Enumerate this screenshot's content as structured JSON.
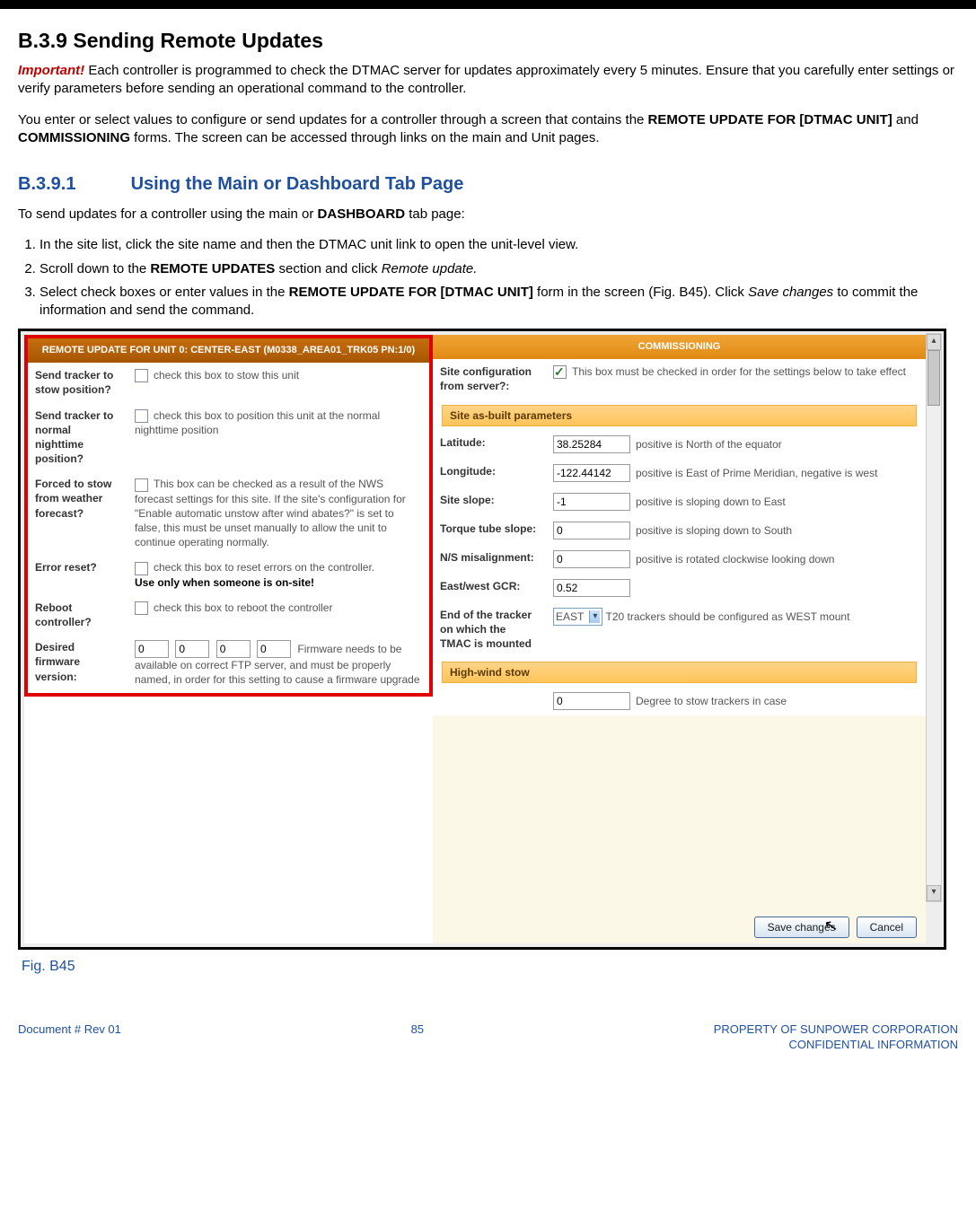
{
  "heading": "B.3.9 Sending Remote Updates",
  "important_label": "Important!",
  "paragraph1": " Each controller is programmed to check the DTMAC server for updates approximately every 5 minutes. Ensure that you carefully enter settings or verify parameters before sending an operational command to the controller.",
  "paragraph2_a": "You enter or select values to configure or send updates for a controller through a screen that contains the ",
  "paragraph2_b": "REMOTE UPDATE FOR [DTMAC UNIT]",
  "paragraph2_c": " and ",
  "paragraph2_d": "COMMISSIONING",
  "paragraph2_e": " forms. The screen can be accessed through links on the main and Unit pages.",
  "subsection_num": "B.3.9.1",
  "subsection_title": "Using the Main or Dashboard Tab Page",
  "intro_a": "To send updates for a controller using the main or ",
  "intro_b": "DASHBOARD",
  "intro_c": " tab page:",
  "steps": {
    "s1": "In the site list, click the site name and then the DTMAC unit link to open the unit-level view.",
    "s2a": "Scroll down to the ",
    "s2b": "REMOTE UPDATES",
    "s2c": " section and click ",
    "s2d": "Remote update.",
    "s3a": "Select check boxes or enter values in the ",
    "s3b": "REMOTE UPDATE FOR [DTMAC UNIT]",
    "s3c": " form in the screen (Fig. B45). Click ",
    "s3d": "Save changes",
    "s3e": " to commit the information and send the command."
  },
  "fig_caption": "Fig. B45",
  "left": {
    "header": "REMOTE UPDATE FOR UNIT 0: CENTER-EAST (M0338_AREA01_TRK05 PN:1/0)",
    "rows": {
      "stow": {
        "label": "Send tracker to stow position?",
        "help": "check this box to stow this unit"
      },
      "night": {
        "label": "Send tracker to normal nighttime position?",
        "help": "check this box to position this unit at the normal nighttime position"
      },
      "forced": {
        "label": "Forced to stow from weather forecast?",
        "help": "This box can be checked as a result of the NWS forecast settings for this site. If the site's configuration for \"Enable automatic unstow after wind abates?\" is set to false, this must be unset manually to allow the unit to continue operating normally."
      },
      "error": {
        "label": "Error reset?",
        "help": "check this box to reset errors on the controller.",
        "warn": "Use only when someone is on-site!"
      },
      "reboot": {
        "label": "Reboot controller?",
        "help": "check this box to reboot the controller"
      },
      "fw": {
        "label": "Desired firmware version:",
        "v": [
          "0",
          "0",
          "0",
          "0"
        ],
        "help": "Firmware needs to be available on correct FTP server, and must be properly named, in order for this setting to cause a firmware upgrade"
      }
    }
  },
  "right": {
    "header": "COMMISSIONING",
    "site_cfg": {
      "label": "Site configuration from server?:",
      "help": "This box must be checked in order for the settings below to take effect"
    },
    "group1": "Site as-built parameters",
    "lat": {
      "label": "Latitude:",
      "value": "38.25284",
      "help": "positive is North of the equator"
    },
    "lon": {
      "label": "Longitude:",
      "value": "-122.44142",
      "help": "positive is East of Prime Meridian, negative is west"
    },
    "slope": {
      "label": "Site slope:",
      "value": "-1",
      "help": "positive is sloping down to East"
    },
    "tts": {
      "label": "Torque tube slope:",
      "value": "0",
      "help": "positive is sloping down to South"
    },
    "ns": {
      "label": "N/S misalignment:",
      "value": "0",
      "help": "positive is rotated clockwise looking down"
    },
    "gcr": {
      "label": "East/west GCR:",
      "value": "0.52",
      "help": ""
    },
    "mount": {
      "label": "End of the tracker on which the TMAC is mounted",
      "value": "EAST",
      "help": "T20 trackers should be configured as WEST mount"
    },
    "group2": "High-wind stow",
    "hw": {
      "value": "0",
      "help": "Degree to stow trackers in case"
    },
    "save": "Save changes",
    "cancel": "Cancel"
  },
  "footer": {
    "left": "Document #  Rev 01",
    "center": "85",
    "r1": "PROPERTY OF SUNPOWER CORPORATION",
    "r2": "CONFIDENTIAL INFORMATION"
  }
}
